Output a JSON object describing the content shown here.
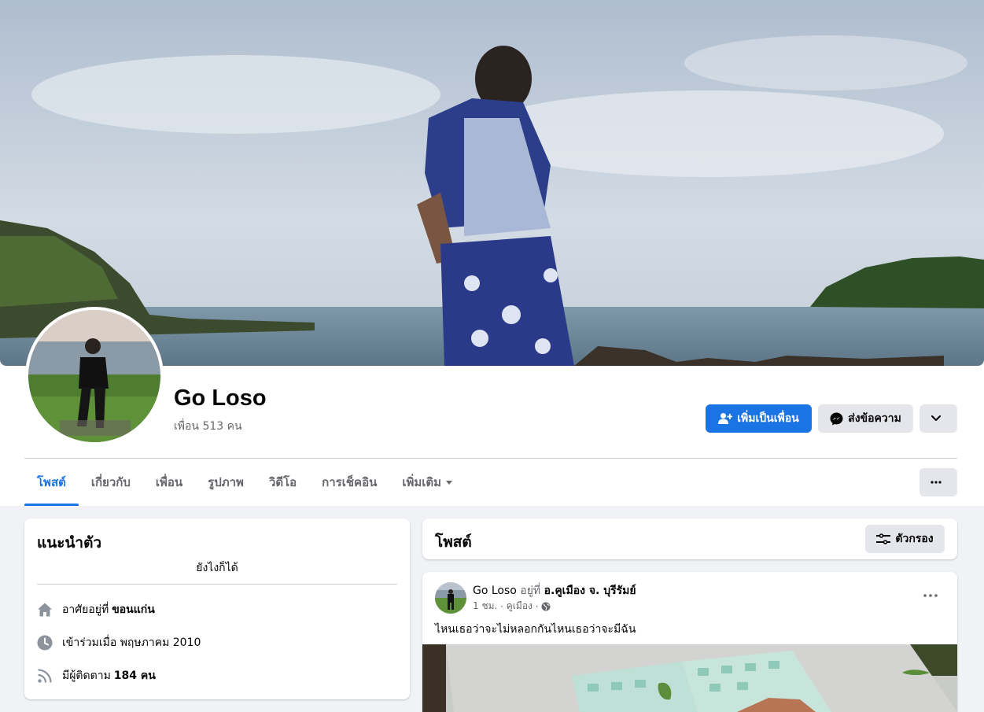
{
  "profile": {
    "name": "Go Loso",
    "friends": "เพื่อน 513 คน"
  },
  "actions": {
    "add_friend": "เพิ่มเป็นเพื่อน",
    "message": "ส่งข้อความ"
  },
  "tabs": [
    {
      "label": "โพสต์",
      "active": true
    },
    {
      "label": "เกี่ยวกับ"
    },
    {
      "label": "เพื่อน"
    },
    {
      "label": "รูปภาพ"
    },
    {
      "label": "วิดีโอ"
    },
    {
      "label": "การเช็คอิน"
    },
    {
      "label": "เพิ่มเติม"
    }
  ],
  "intro": {
    "title": "แนะนำตัว",
    "bio": "ยังไงก็ได้",
    "lives_prefix": "อาศัยอยู่ที่",
    "lives_value": "ขอนแก่น",
    "joined": "เข้าร่วมเมื่อ พฤษภาคม 2010",
    "followers_prefix": "มีผู้ติดตาม",
    "followers_value": "184 คน"
  },
  "posts_header": {
    "title": "โพสต์",
    "filter_label": "ตัวกรอง"
  },
  "post": {
    "author": "Go Loso",
    "at_text": "อยู่ที่",
    "location": "อ.คูเมือง จ. บุรีรัมย์",
    "time": "1 ชม.",
    "place_short": "คูเมือง",
    "text": "ไหนเธอว่าจะไม่หลอกกันไหนเธอว่าจะมีฉัน"
  },
  "colors": {
    "accent": "#1b74e4",
    "page_bg": "#f0f2f5",
    "muted_text": "#65676b"
  },
  "icons": {
    "add_friend": "person-plus-icon",
    "message": "messenger-icon",
    "dropdown": "chevron-down-icon",
    "more": "more-dots-icon",
    "filter": "filter-sliders-icon",
    "home": "home-icon",
    "clock": "clock-icon",
    "rss": "rss-icon",
    "globe": "globe-icon"
  }
}
